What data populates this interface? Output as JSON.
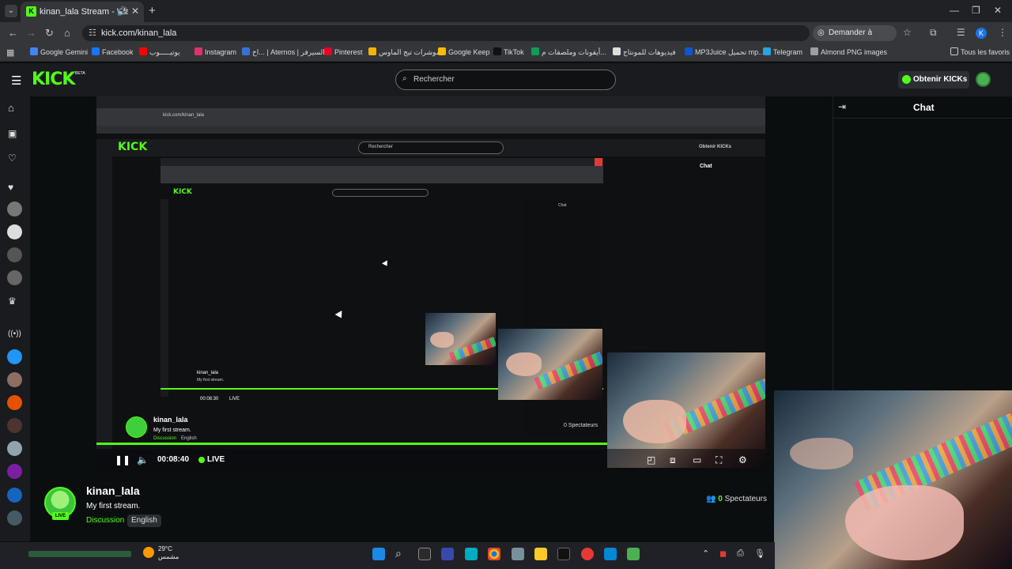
{
  "browser": {
    "tab_title": "kinan_lala Stream - Watch l",
    "url": "kick.com/kinan_lala",
    "google_button": "Demander à Google",
    "profile_initial": "K",
    "bookmarks": [
      {
        "label": "Google Gemini",
        "color": "#4285f4"
      },
      {
        "label": "Facebook",
        "color": "#1877f2"
      },
      {
        "label": "يوتيـــــوب",
        "color": "#ff0000"
      },
      {
        "label": "Instagram",
        "color": "#e1306c"
      },
      {
        "label": "اخ... | Aternos | السيرفر",
        "color": "#3a6fd8"
      },
      {
        "label": "Pinterest",
        "color": "#e60023"
      },
      {
        "label": "موشرات تيج الماوس",
        "color": "#f4b400"
      },
      {
        "label": "Google Keep",
        "color": "#fbbc04"
      },
      {
        "label": "TikTok",
        "color": "#111111"
      },
      {
        "label": "أيقونات وملصقات م...",
        "color": "#0f9d58"
      },
      {
        "label": "فيديوهات للمونتاج",
        "color": "#dddddd"
      },
      {
        "label": "MP3Juice تحميل mp...",
        "color": "#0b57d0"
      },
      {
        "label": "Telegram",
        "color": "#2aa3df"
      },
      {
        "label": "Almond PNG images",
        "color": "#9e9e9e"
      }
    ],
    "all_bookmarks": "Tous les favoris"
  },
  "header": {
    "logo": "KICK",
    "logo_badge": "BETA",
    "search_placeholder": "Rechercher",
    "kicks_button": "Obtenir KICKs"
  },
  "player": {
    "time": "00:08:40",
    "live_label": "LIVE",
    "nested_logo": "KICK",
    "nested_search": "Rechercher",
    "nested_kicks": "Obtenir KICKs",
    "nested_chat": "Chat",
    "nested_name": "kinan_lala",
    "nested_title": "My first stream.",
    "nested_category": "Discussion",
    "nested_lang": "English",
    "nested_viewers": "0 Spectateurs",
    "nested_time": "00:08:30",
    "nested_live": "LIVE"
  },
  "chat": {
    "title": "Chat"
  },
  "stream": {
    "name": "kinan_lala",
    "title": "My first stream.",
    "category": "Discussion",
    "language": "English",
    "viewers_count": "0",
    "viewers_label": "Spectateurs",
    "live_badge": "LIVE"
  },
  "taskbar": {
    "temperature": "29°C",
    "weather": "مشمس"
  }
}
